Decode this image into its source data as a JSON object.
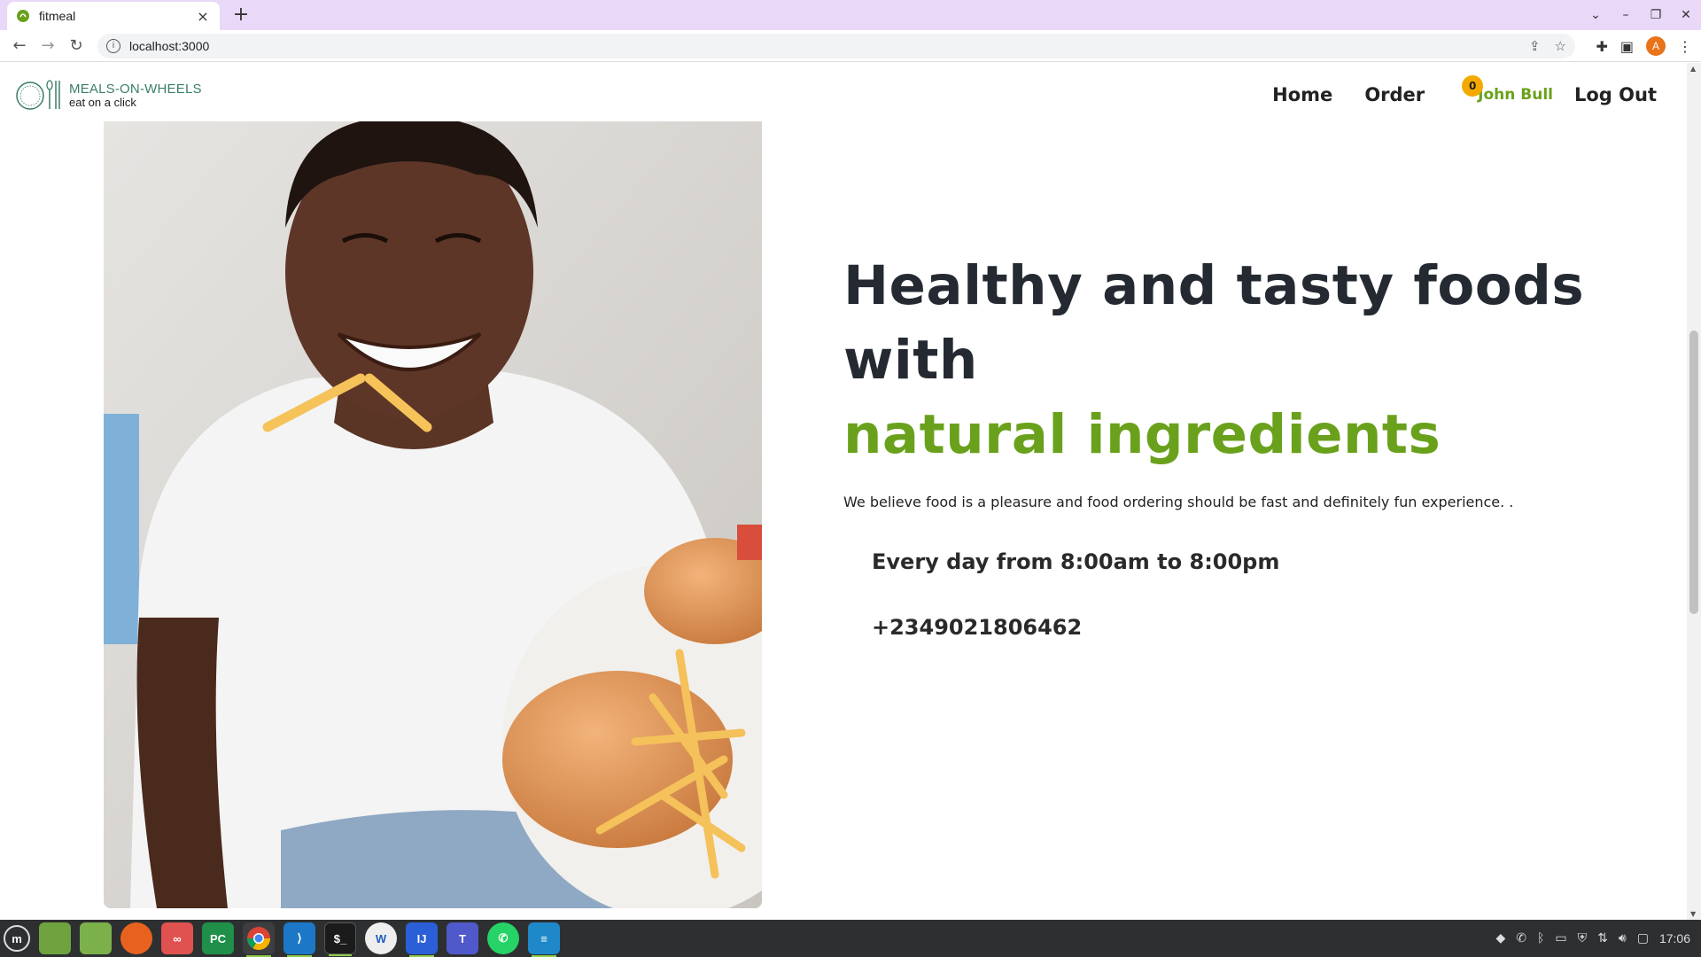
{
  "browser": {
    "tab_title": "fitmeal",
    "tab_close": "×",
    "new_tab": "+",
    "url": "localhost:3000",
    "avatar_initial": "A"
  },
  "header": {
    "logo_name": "MEALS-ON-WHEELS",
    "logo_tagline": "eat on a click",
    "nav": {
      "home": "Home",
      "order": "Order",
      "user": "John Bull",
      "cart_count": "0",
      "logout": "Log Out"
    }
  },
  "hero": {
    "title": "Healthy and tasty foods with",
    "title_accent": "natural ingredients",
    "description": "We believe food is a pleasure and food ordering should be fast and definitely fun experience. .",
    "hours": "Every day from 8:00am to 8:00pm",
    "phone": "+2349021806462"
  },
  "taskbar": {
    "clock": "17:06",
    "apps": [
      "mint-menu",
      "desktop",
      "files",
      "firefox",
      "sticky-notes",
      "pycharm",
      "chrome",
      "vscode",
      "terminal",
      "wps",
      "intellij",
      "teams",
      "whatsapp",
      "text-editor"
    ]
  },
  "colors": {
    "accent_green": "#6aa11c",
    "title_dark": "#252a32",
    "badge": "#f4a900",
    "tabstrip": "#e9d8f8"
  }
}
